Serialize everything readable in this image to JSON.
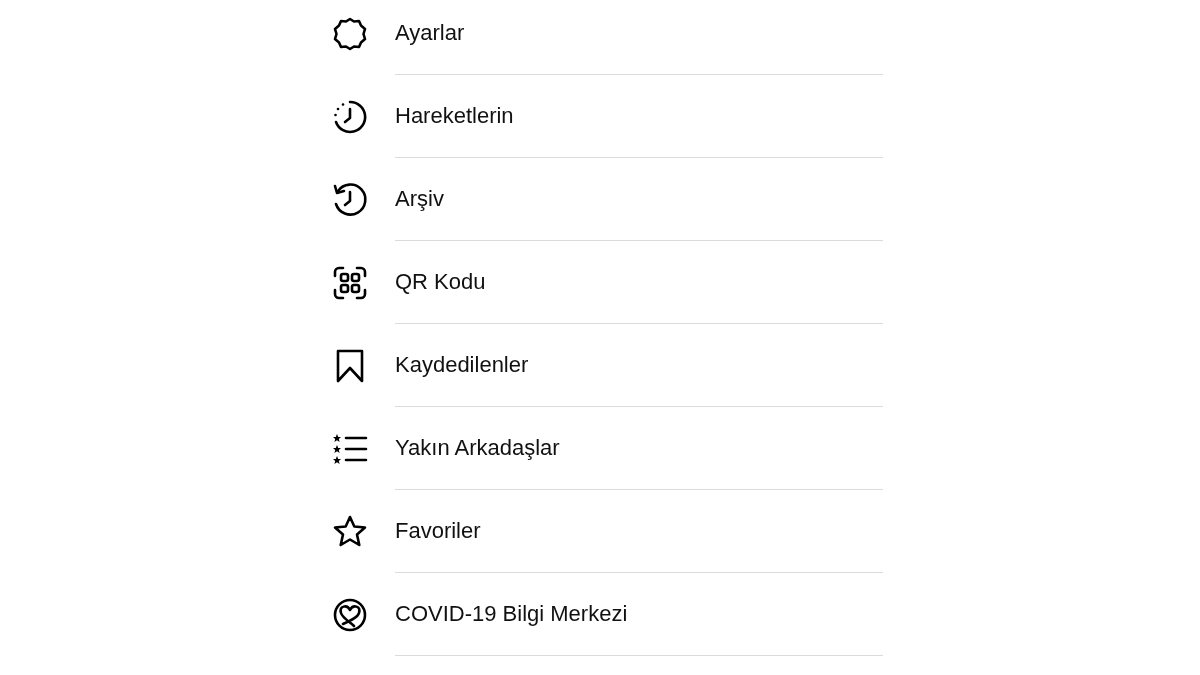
{
  "menu": [
    {
      "kind": "settings",
      "label": "Ayarlar"
    },
    {
      "kind": "activity",
      "label": "Hareketlerin"
    },
    {
      "kind": "archive",
      "label": "Arşiv"
    },
    {
      "kind": "qr",
      "label": "QR Kodu"
    },
    {
      "kind": "bookmark",
      "label": "Kaydedilenler"
    },
    {
      "kind": "close-friends",
      "label": "Yakın Arkadaşlar"
    },
    {
      "kind": "star",
      "label": "Favoriler"
    },
    {
      "kind": "covid",
      "label": "COVID-19 Bilgi Merkezi"
    }
  ]
}
